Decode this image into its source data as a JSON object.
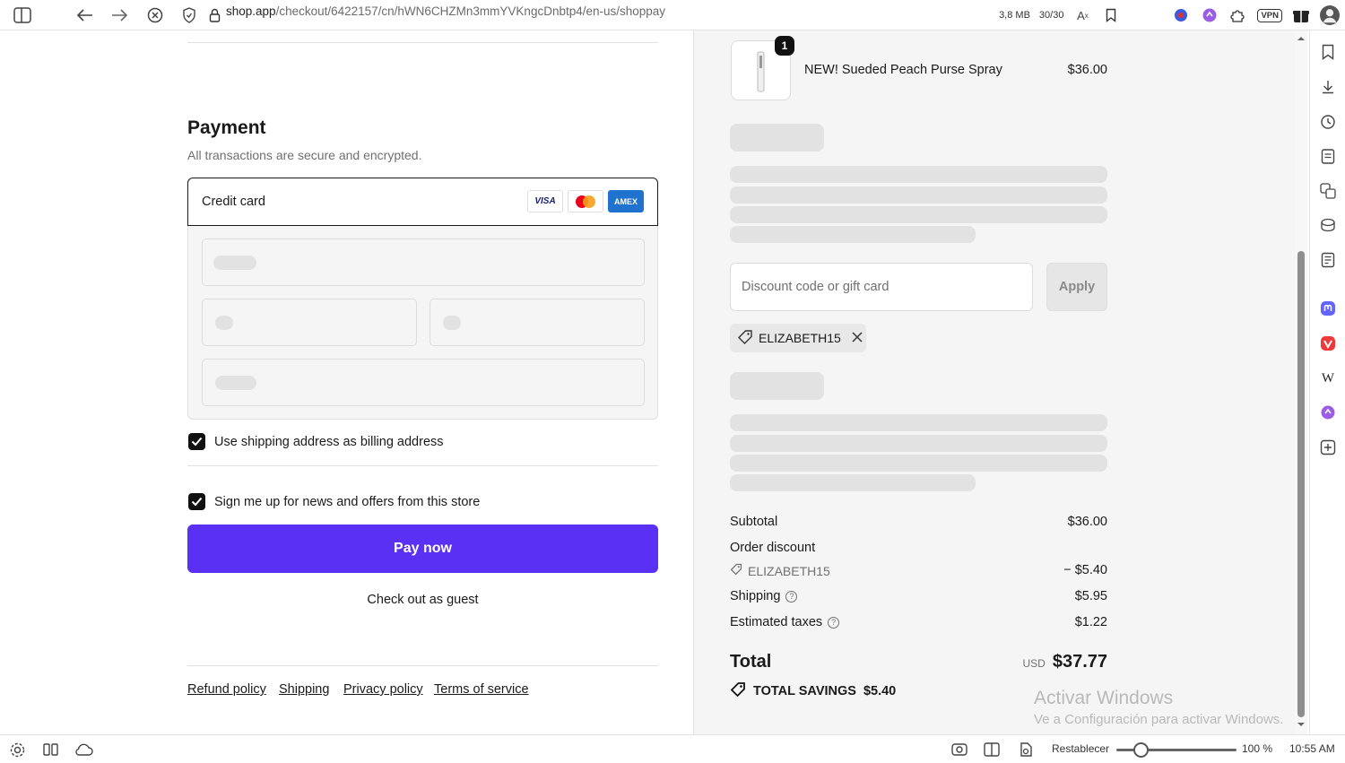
{
  "browser": {
    "url_host": "shop.app",
    "url_path": "/checkout/6422157/cn/hWN6CHZMn3mmYVKngcDnbtp4/en-us/shoppay",
    "memory": "3,8 MB",
    "tab_count": "30/30",
    "vpn_label": "VPN"
  },
  "payment": {
    "title": "Payment",
    "subtitle": "All transactions are secure and encrypted.",
    "method_label": "Credit card",
    "cards": [
      "VISA",
      "AMEX"
    ],
    "billing_checkbox_label": "Use shipping address as billing address",
    "news_checkbox_label": "Sign me up for news and offers from this store",
    "pay_button": "Pay now",
    "guest_link": "Check out as guest"
  },
  "footer_links": [
    "Refund policy",
    "Shipping",
    "Privacy policy",
    "Terms of service"
  ],
  "summary": {
    "item": {
      "name": "NEW! Sueded Peach Purse Spray",
      "price": "$36.00",
      "quantity": "1"
    },
    "discount_placeholder": "Discount code or gift card",
    "apply_button": "Apply",
    "applied_code": "ELIZABETH15",
    "subtotal_label": "Subtotal",
    "subtotal_value": "$36.00",
    "order_discount_label": "Order discount",
    "order_discount_code": "ELIZABETH15",
    "order_discount_value": "− $5.40",
    "shipping_label": "Shipping",
    "shipping_value": "$5.95",
    "taxes_label": "Estimated taxes",
    "taxes_value": "$1.22",
    "total_label": "Total",
    "total_currency": "USD",
    "total_value": "$37.77",
    "savings_label": "TOTAL SAVINGS",
    "savings_value": "$5.40"
  },
  "watermark": {
    "line1": "Activar Windows",
    "line2": "Ve a Configuración para activar Windows."
  },
  "statusbar": {
    "reset_label": "Restablecer",
    "zoom": "100 %",
    "time": "10:55 AM"
  },
  "colors": {
    "primary": "#5a31f4",
    "skeleton": "#e2e2e2"
  }
}
